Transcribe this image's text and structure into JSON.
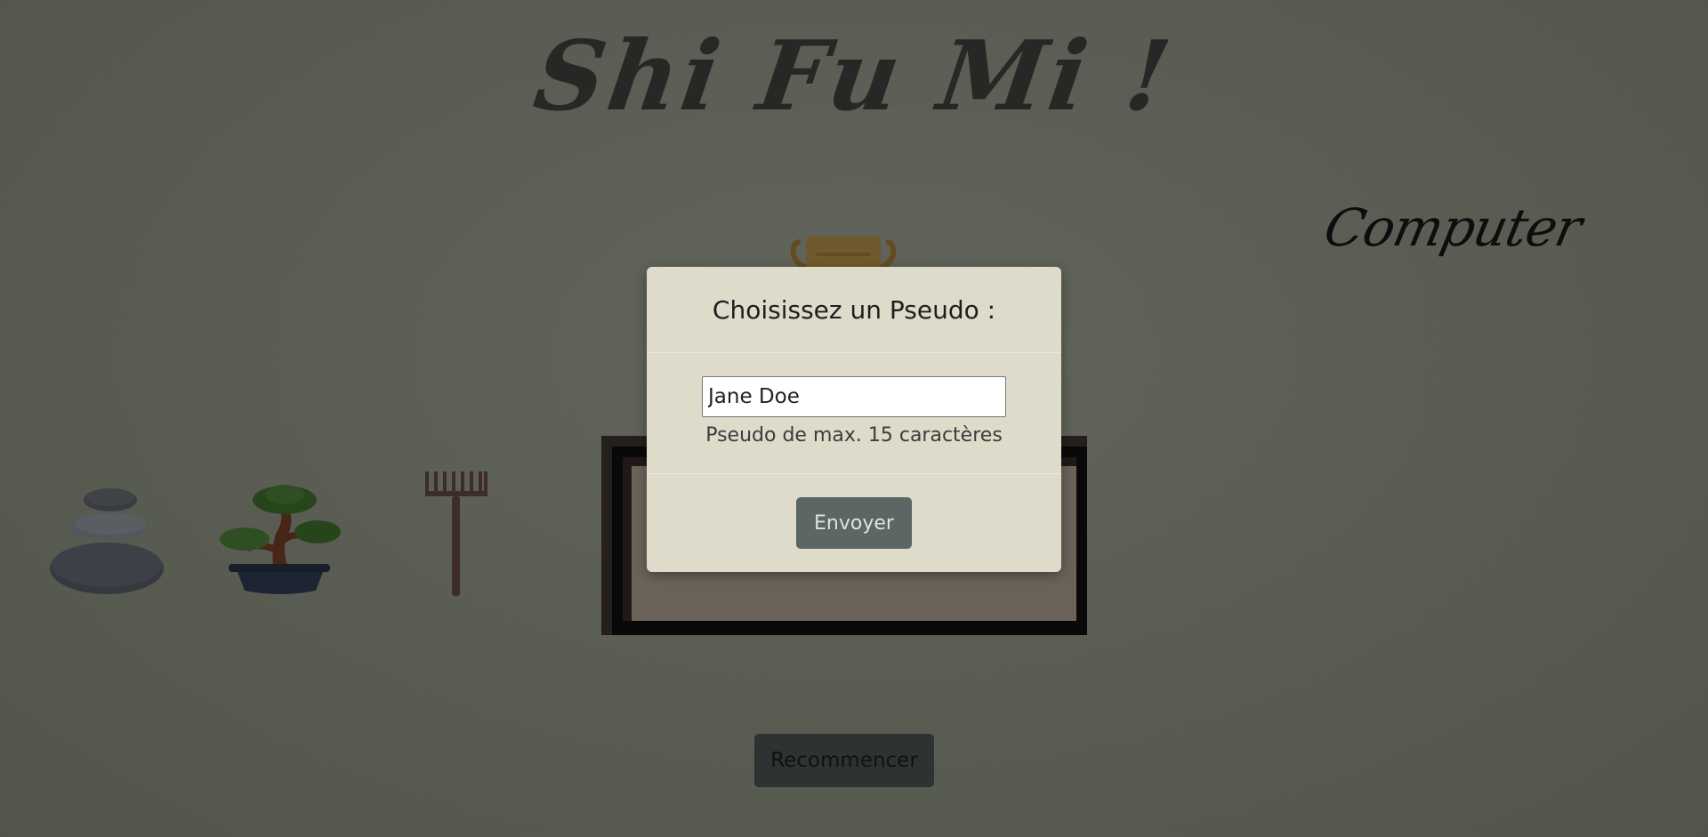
{
  "game": {
    "title": "Shi Fu Mi !",
    "opponent_label": "Computer",
    "choices": [
      {
        "name": "stones",
        "icon": "stones-icon"
      },
      {
        "name": "bonsai",
        "icon": "bonsai-icon"
      },
      {
        "name": "rake",
        "icon": "rake-icon"
      }
    ],
    "trophy_icon": "trophy-icon",
    "restart_label": "Recommencer"
  },
  "modal": {
    "title": "Choisissez un Pseudo :",
    "input_value": "Jane Doe",
    "hint": "Pseudo de max. 15 caractères",
    "submit_label": "Envoyer"
  },
  "colors": {
    "background": "#b7bca9",
    "modal_background": "#dedbca",
    "button": "#5c6665",
    "overlay": "rgba(0,0,0,0.5)"
  }
}
